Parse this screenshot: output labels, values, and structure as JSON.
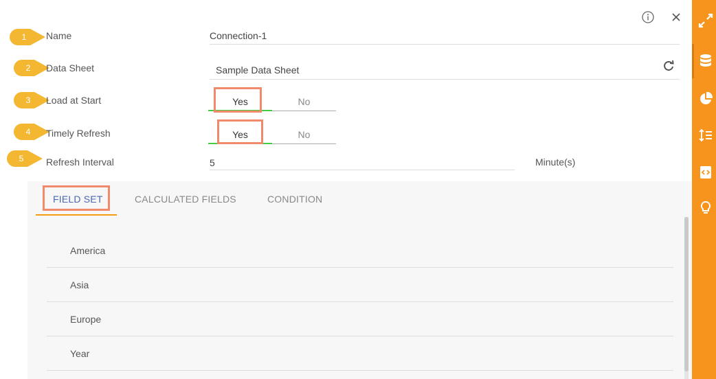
{
  "form": {
    "fields": [
      {
        "marker": "1",
        "label": "Name",
        "value": "Connection-1"
      },
      {
        "marker": "2",
        "label": "Data Sheet",
        "value": "Sample Data Sheet"
      },
      {
        "marker": "3",
        "label": "Load at Start",
        "yes": "Yes",
        "no": "No"
      },
      {
        "marker": "4",
        "label": "Timely Refresh",
        "yes": "Yes",
        "no": "No"
      },
      {
        "marker": "5",
        "label": "Refresh Interval",
        "value": "5",
        "unit": "Minute(s)"
      }
    ]
  },
  "header": {
    "info_icon": "info-circle-icon",
    "close_icon": "close-x-icon"
  },
  "tabs": [
    {
      "label": "FIELD SET",
      "active": true
    },
    {
      "label": "CALCULATED FIELDS",
      "active": false
    },
    {
      "label": "CONDITION",
      "active": false
    }
  ],
  "field_set": [
    "America",
    "Asia",
    "Europe",
    "Year"
  ],
  "sidebar": {
    "icons": [
      "expand-arrows-icon",
      "database-icon",
      "pie-chart-icon",
      "sort-list-icon",
      "script-icon",
      "lightbulb-icon"
    ],
    "color": "#f7941d"
  },
  "colors": {
    "marker": "#f4b731",
    "highlight": "#f08a6a",
    "toggle_active": "#44cc44",
    "tab_active": "#4a67b0",
    "tab_underline": "#f39c12"
  }
}
